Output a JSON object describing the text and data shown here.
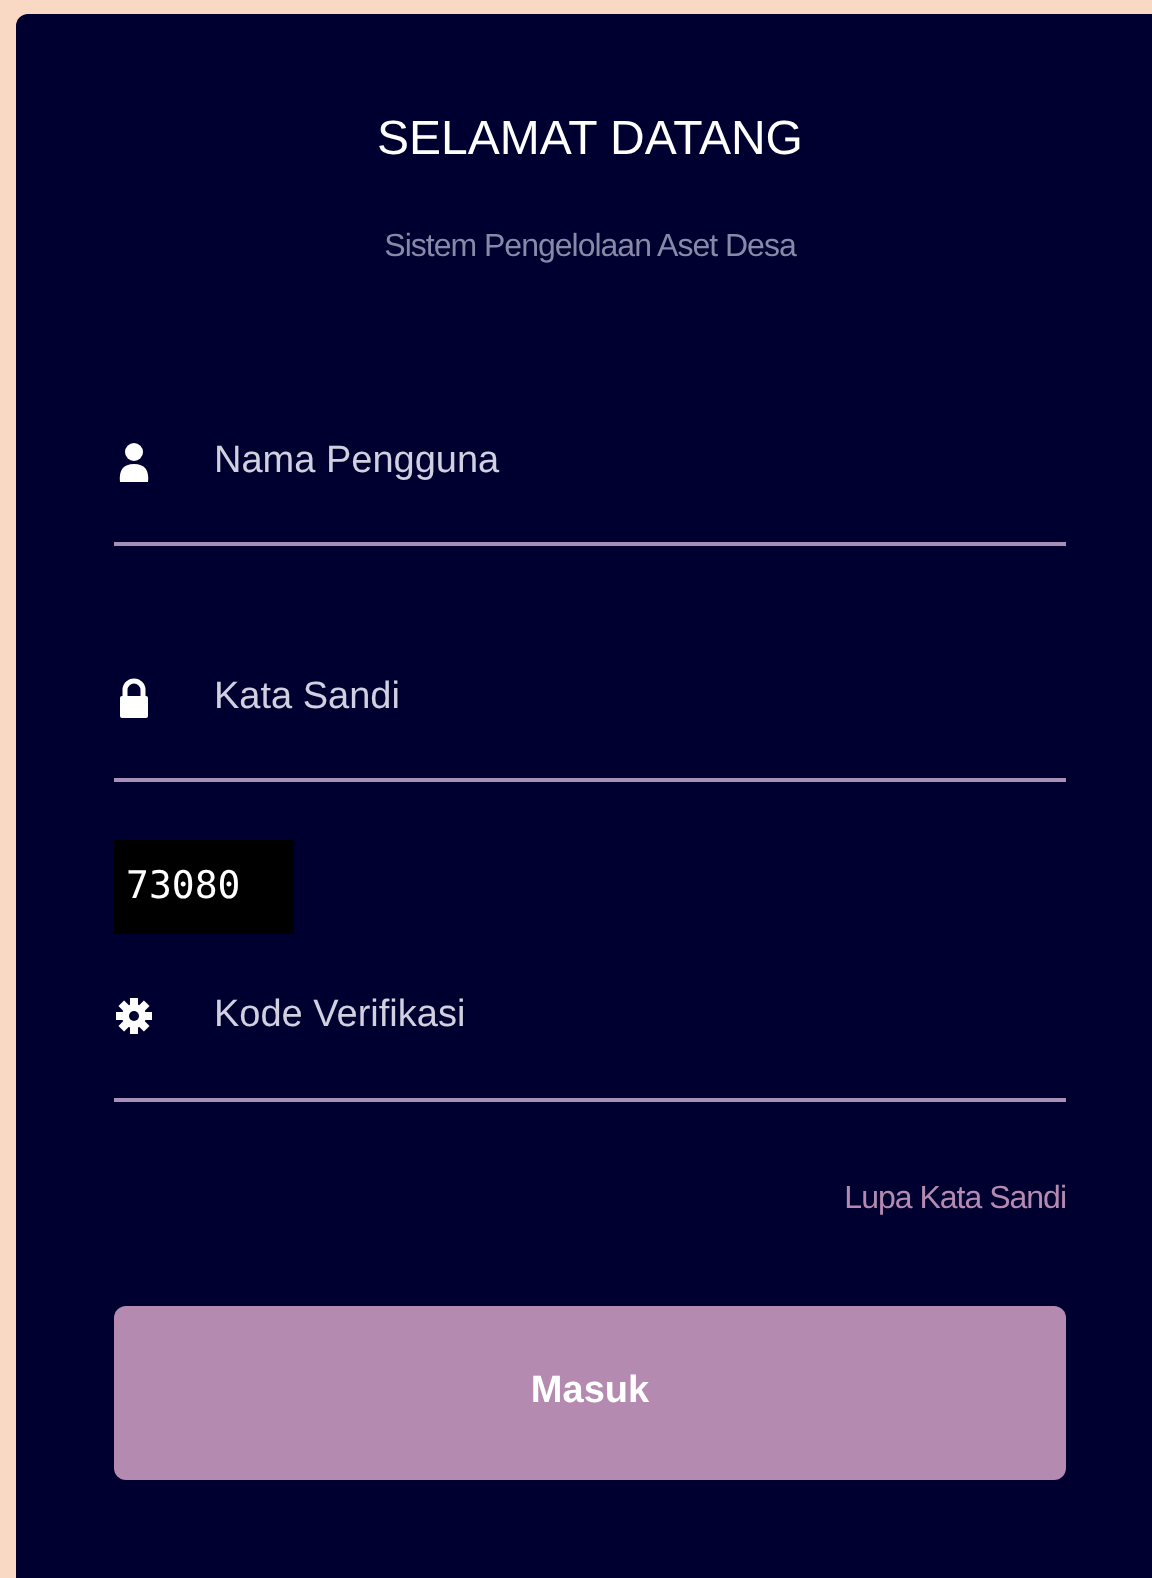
{
  "title": "SELAMAT DATANG",
  "subtitle": "Sistem Pengelolaan Aset Desa",
  "fields": [
    {
      "kind": "user",
      "placeholder": "Nama Pengguna"
    },
    {
      "kind": "lock",
      "placeholder": "Kata Sandi",
      "captcha": "73080"
    },
    {
      "kind": "gear",
      "placeholder": "Kode Verifikasi"
    }
  ],
  "forgot_link": "Lupa Kata Sandi",
  "submit_button": "Masuk"
}
